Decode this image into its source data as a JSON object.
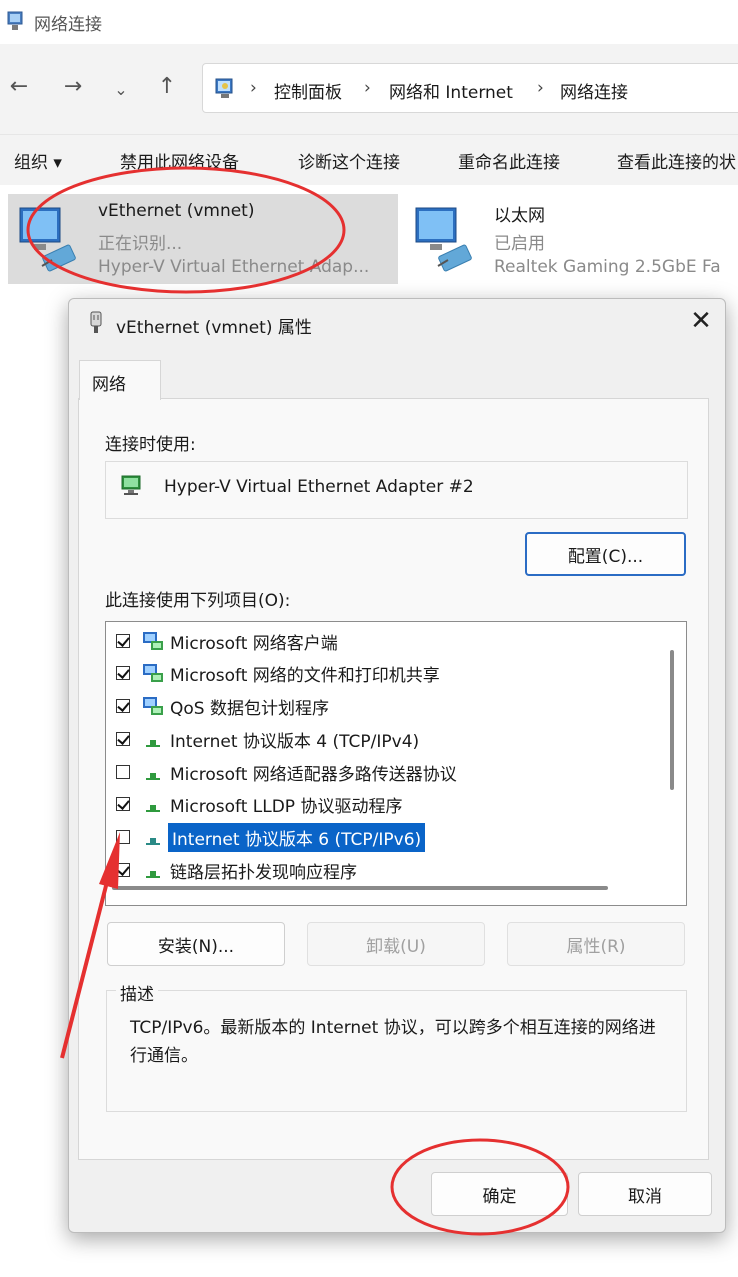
{
  "window": {
    "title": "网络连接"
  },
  "address_bar": {
    "crumbs": [
      "控制面板",
      "网络和 Internet",
      "网络连接"
    ]
  },
  "toolbar": {
    "items": [
      "组织 ▾",
      "禁用此网络设备",
      "诊断这个连接",
      "重命名此连接",
      "查看此连接的状"
    ]
  },
  "adapters": [
    {
      "name": "vEthernet (vmnet)",
      "status": "正在识别...",
      "device": "Hyper-V Virtual Ethernet Adap..."
    },
    {
      "name": "以太网",
      "status": "已启用",
      "device": "Realtek Gaming 2.5GbE Fa"
    }
  ],
  "dialog": {
    "title": "vEthernet (vmnet) 属性",
    "tab": "网络",
    "connect_using_label": "连接时使用:",
    "adapter_name": "Hyper-V Virtual Ethernet Adapter #2",
    "configure_button": "配置(C)...",
    "items_label": "此连接使用下列项目(O):",
    "items": [
      {
        "label": "Microsoft 网络客户端",
        "checked": true,
        "icon": "network-client-icon"
      },
      {
        "label": "Microsoft 网络的文件和打印机共享",
        "checked": true,
        "icon": "file-share-icon"
      },
      {
        "label": "QoS 数据包计划程序",
        "checked": true,
        "icon": "qos-icon"
      },
      {
        "label": "Internet 协议版本 4 (TCP/IPv4)",
        "checked": true,
        "icon": "protocol-icon"
      },
      {
        "label": "Microsoft 网络适配器多路传送器协议",
        "checked": false,
        "icon": "protocol-icon"
      },
      {
        "label": "Microsoft LLDP 协议驱动程序",
        "checked": true,
        "icon": "protocol-icon"
      },
      {
        "label": "Internet 协议版本 6 (TCP/IPv6)",
        "checked": false,
        "selected": true,
        "icon": "protocol-icon"
      },
      {
        "label": "链路层拓扑发现响应程序",
        "checked": true,
        "icon": "protocol-icon"
      }
    ],
    "install_button": "安装(N)...",
    "uninstall_button": "卸载(U)",
    "properties_button": "属性(R)",
    "description_label": "描述",
    "description_text": "TCP/IPv6。最新版本的 Internet 协议，可以跨多个相互连接的网络进行通信。",
    "ok_button": "确定",
    "cancel_button": "取消"
  },
  "colors": {
    "selection": "#0a64c8",
    "annotation": "#e53030",
    "focus": "#2b6cc4"
  }
}
